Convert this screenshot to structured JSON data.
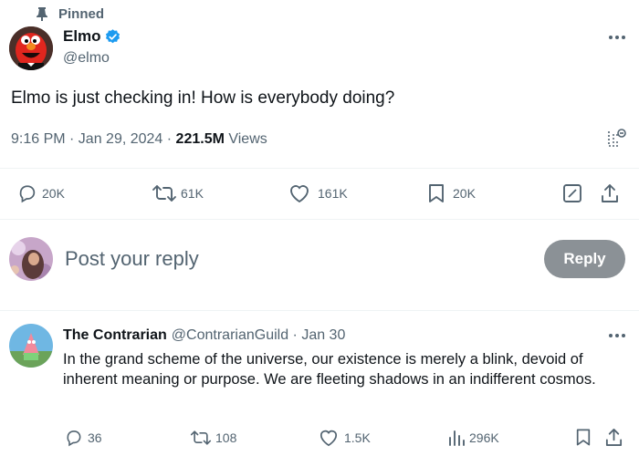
{
  "pinned": {
    "label": "Pinned"
  },
  "tweet": {
    "author_name": "Elmo",
    "handle": "@elmo",
    "text": "Elmo is just checking in! How is everybody doing?",
    "time": "9:16 PM · Jan 29, 2024 · ",
    "views_count": "221.5M",
    "views_label": " Views",
    "metrics": {
      "replies": "20K",
      "reposts": "61K",
      "likes": "161K",
      "bookmarks": "20K"
    }
  },
  "composer": {
    "placeholder": "Post your reply",
    "reply_button": "Reply"
  },
  "reply": {
    "author_name": "The Contrarian",
    "handle": "@ContrarianGuild",
    "separator": " · ",
    "date": "Jan 30",
    "text": "In the grand scheme of the universe, our existence is merely a blink, devoid of inherent meaning or purpose. We are fleeting shadows in an indifferent cosmos.",
    "metrics": {
      "replies": "36",
      "reposts": "108",
      "likes": "1.5K",
      "views": "296K"
    }
  },
  "colors": {
    "verified": "#1d9bf0",
    "text": "#0f1419",
    "secondary": "#536471",
    "reply_button_bg": "#8b9196",
    "divider": "#eff3f4"
  },
  "icons": [
    "pin-icon",
    "verified-badge-icon",
    "more-icon",
    "analytics-icon",
    "reply-icon",
    "repost-icon",
    "like-icon",
    "bookmark-icon",
    "edit-icon",
    "share-icon",
    "views-icon"
  ]
}
